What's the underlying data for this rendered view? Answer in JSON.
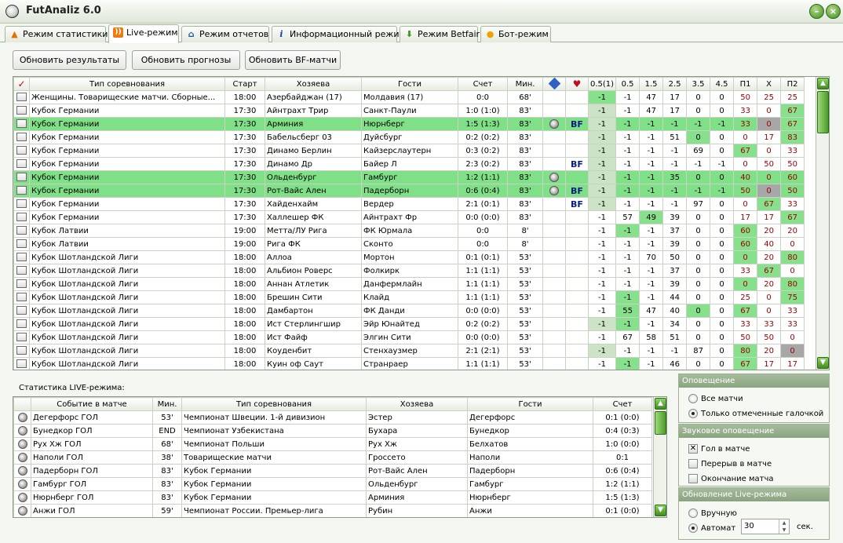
{
  "window": {
    "title": "FutAnaliz 6.0"
  },
  "tabs": [
    {
      "label": "Режим статистики",
      "icon": "warning-icon",
      "color": "#e07000"
    },
    {
      "label": "Live-режим",
      "icon": "rss-icon",
      "color": "#f07a10"
    },
    {
      "label": "Режим отчетов",
      "icon": "home-icon",
      "color": "#2055a0"
    },
    {
      "label": "Информационный режим",
      "icon": "info-icon",
      "color": "#1a3fb0"
    },
    {
      "label": "Режим Betfair",
      "icon": "arrow-down-icon",
      "color": "#3a9a20"
    },
    {
      "label": "Бот-режим",
      "icon": "chat-bubble-icon",
      "color": "#f0a000"
    }
  ],
  "toolbar": {
    "refresh_results": "Обновить результаты",
    "refresh_forecasts": "Обновить прогнозы",
    "refresh_bf": "Обновить BF-матчи"
  },
  "main_table": {
    "check_header": "✓",
    "columns": [
      "Тип соревнования",
      "Старт",
      "Хозяева",
      "Гости",
      "Счет",
      "Мин.",
      "",
      "",
      "0.5(1)",
      "0.5",
      "1.5",
      "2.5",
      "3.5",
      "4.5",
      "П1",
      "X",
      "П2"
    ],
    "rows": [
      {
        "comp": "Женщины. Товарищеские матчи. Сборные...",
        "start": "18:00",
        "home": "Азербайджан (17)",
        "away": "Молдавия (17)",
        "score": "0:0",
        "min": "68'",
        "ball": false,
        "bf": false,
        "o05h": "-1",
        "o05": "-1",
        "o15": "47",
        "o25": "17",
        "o35": "0",
        "o45": "0",
        "p1": "50",
        "x": "25",
        "p2": "25",
        "hl": false,
        "green": [
          "o05h"
        ],
        "gray": [],
        "lg": [
          "o05h"
        ]
      },
      {
        "comp": "Кубок Германии",
        "start": "17:30",
        "home": "Айнтрахт Трир",
        "away": "Санкт-Паули",
        "score": "1:0 (1:0)",
        "min": "83'",
        "ball": false,
        "bf": false,
        "o05h": "-1",
        "o05": "-1",
        "o15": "47",
        "o25": "17",
        "o35": "0",
        "o45": "0",
        "p1": "33",
        "x": "0",
        "p2": "67",
        "hl": false,
        "green": [
          "p2"
        ],
        "gray": [],
        "lg": [
          "o05h"
        ]
      },
      {
        "comp": "Кубок Германии",
        "start": "17:30",
        "home": "Арминия",
        "away": "Нюрнберг",
        "score": "1:5 (1:3)",
        "min": "83'",
        "ball": true,
        "bf": true,
        "o05h": "-1",
        "o05": "-1",
        "o15": "-1",
        "o25": "-1",
        "o35": "-1",
        "o45": "-1",
        "p1": "33",
        "x": "0",
        "p2": "67",
        "hl": true,
        "green": [
          "p2"
        ],
        "gray": [
          "x"
        ],
        "lg": [
          "o05h"
        ]
      },
      {
        "comp": "Кубок Германии",
        "start": "17:30",
        "home": "Бабельсберг 03",
        "away": "Дуйсбург",
        "score": "0:2 (0:2)",
        "min": "83'",
        "ball": false,
        "bf": false,
        "o05h": "-1",
        "o05": "-1",
        "o15": "-1",
        "o25": "51",
        "o35": "0",
        "o45": "0",
        "p1": "0",
        "x": "17",
        "p2": "83",
        "hl": false,
        "green": [
          "o35",
          "p2"
        ],
        "gray": [],
        "lg": [
          "o05h"
        ]
      },
      {
        "comp": "Кубок Германии",
        "start": "17:30",
        "home": "Динамо Берлин",
        "away": "Кайзерслаутерн",
        "score": "0:3 (0:2)",
        "min": "83'",
        "ball": false,
        "bf": false,
        "o05h": "-1",
        "o05": "-1",
        "o15": "-1",
        "o25": "-1",
        "o35": "69",
        "o45": "0",
        "p1": "67",
        "x": "0",
        "p2": "33",
        "hl": false,
        "green": [
          "p1"
        ],
        "gray": [],
        "lg": [
          "o05h"
        ]
      },
      {
        "comp": "Кубок Германии",
        "start": "17:30",
        "home": "Динамо Др",
        "away": "Байер Л",
        "score": "2:3 (0:2)",
        "min": "83'",
        "ball": false,
        "bf": true,
        "o05h": "-1",
        "o05": "-1",
        "o15": "-1",
        "o25": "-1",
        "o35": "-1",
        "o45": "-1",
        "p1": "0",
        "x": "50",
        "p2": "50",
        "hl": false,
        "green": [],
        "gray": [],
        "lg": [
          "o05h"
        ]
      },
      {
        "comp": "Кубок Германии",
        "start": "17:30",
        "home": "Ольденбург",
        "away": "Гамбург",
        "score": "1:2 (1:1)",
        "min": "83'",
        "ball": true,
        "bf": false,
        "o05h": "-1",
        "o05": "-1",
        "o15": "-1",
        "o25": "35",
        "o35": "0",
        "o45": "0",
        "p1": "40",
        "x": "0",
        "p2": "60",
        "hl": true,
        "green": [],
        "gray": [],
        "lg": [
          "o05h"
        ]
      },
      {
        "comp": "Кубок Германии",
        "start": "17:30",
        "home": "Рот-Вайс Ален",
        "away": "Падерборн",
        "score": "0:6 (0:4)",
        "min": "83'",
        "ball": true,
        "bf": true,
        "o05h": "-1",
        "o05": "-1",
        "o15": "-1",
        "o25": "-1",
        "o35": "-1",
        "o45": "-1",
        "p1": "50",
        "x": "0",
        "p2": "50",
        "hl": true,
        "green": [],
        "gray": [
          "x"
        ],
        "lg": [
          "o05h"
        ]
      },
      {
        "comp": "Кубок Германии",
        "start": "17:30",
        "home": "Хайденхайм",
        "away": "Вердер",
        "score": "2:1 (0:1)",
        "min": "83'",
        "ball": false,
        "bf": true,
        "o05h": "-1",
        "o05": "-1",
        "o15": "-1",
        "o25": "-1",
        "o35": "97",
        "o45": "0",
        "p1": "0",
        "x": "67",
        "p2": "33",
        "hl": false,
        "green": [
          "x"
        ],
        "gray": [],
        "lg": [
          "o05h"
        ]
      },
      {
        "comp": "Кубок Германии",
        "start": "17:30",
        "home": "Халлешер ФК",
        "away": "Айнтрахт Фр",
        "score": "0:0 (0:0)",
        "min": "83'",
        "ball": false,
        "bf": false,
        "o05h": "-1",
        "o05": "57",
        "o15": "49",
        "o25": "39",
        "o35": "0",
        "o45": "0",
        "p1": "17",
        "x": "17",
        "p2": "67",
        "hl": false,
        "green": [
          "o15",
          "p2"
        ],
        "gray": [],
        "lg": []
      },
      {
        "comp": "Кубок Латвии",
        "start": "19:00",
        "home": "Метта/ЛУ Рига",
        "away": "ФК Юрмала",
        "score": "0:0",
        "min": "8'",
        "ball": false,
        "bf": false,
        "o05h": "-1",
        "o05": "-1",
        "o15": "-1",
        "o25": "37",
        "o35": "0",
        "o45": "0",
        "p1": "60",
        "x": "20",
        "p2": "20",
        "hl": false,
        "green": [
          "o05",
          "p1"
        ],
        "gray": [],
        "lg": []
      },
      {
        "comp": "Кубок Латвии",
        "start": "19:00",
        "home": "Рига ФК",
        "away": "Сконто",
        "score": "0:0",
        "min": "8'",
        "ball": false,
        "bf": false,
        "o05h": "-1",
        "o05": "-1",
        "o15": "-1",
        "o25": "39",
        "o35": "0",
        "o45": "0",
        "p1": "60",
        "x": "40",
        "p2": "0",
        "hl": false,
        "green": [
          "p1"
        ],
        "gray": [],
        "lg": []
      },
      {
        "comp": "Кубок Шотландской Лиги",
        "start": "18:00",
        "home": "Аллоа",
        "away": "Мортон",
        "score": "0:1 (0:1)",
        "min": "53'",
        "ball": false,
        "bf": false,
        "o05h": "-1",
        "o05": "-1",
        "o15": "70",
        "o25": "50",
        "o35": "0",
        "o45": "0",
        "p1": "0",
        "x": "20",
        "p2": "80",
        "hl": false,
        "green": [
          "p1",
          "p2"
        ],
        "gray": [],
        "lg": []
      },
      {
        "comp": "Кубок Шотландской Лиги",
        "start": "18:00",
        "home": "Альбион Роверс",
        "away": "Фолкирк",
        "score": "1:1 (1:1)",
        "min": "53'",
        "ball": false,
        "bf": false,
        "o05h": "-1",
        "o05": "-1",
        "o15": "-1",
        "o25": "37",
        "o35": "0",
        "o45": "0",
        "p1": "33",
        "x": "67",
        "p2": "0",
        "hl": false,
        "green": [
          "x"
        ],
        "gray": [],
        "lg": []
      },
      {
        "comp": "Кубок Шотландской Лиги",
        "start": "18:00",
        "home": "Аннан Атлетик",
        "away": "Данфермлайн",
        "score": "1:1 (1:1)",
        "min": "53'",
        "ball": false,
        "bf": false,
        "o05h": "-1",
        "o05": "-1",
        "o15": "-1",
        "o25": "39",
        "o35": "0",
        "o45": "0",
        "p1": "0",
        "x": "20",
        "p2": "80",
        "hl": false,
        "green": [
          "p1",
          "p2"
        ],
        "gray": [],
        "lg": []
      },
      {
        "comp": "Кубок Шотландской Лиги",
        "start": "18:00",
        "home": "Брешин Сити",
        "away": "Клайд",
        "score": "1:1 (1:1)",
        "min": "53'",
        "ball": false,
        "bf": false,
        "o05h": "-1",
        "o05": "-1",
        "o15": "-1",
        "o25": "44",
        "o35": "0",
        "o45": "0",
        "p1": "25",
        "x": "0",
        "p2": "75",
        "hl": false,
        "green": [
          "o05",
          "p2"
        ],
        "gray": [],
        "lg": []
      },
      {
        "comp": "Кубок Шотландской Лиги",
        "start": "18:00",
        "home": "Дамбартон",
        "away": "ФК Данди",
        "score": "0:0 (0:0)",
        "min": "53'",
        "ball": false,
        "bf": false,
        "o05h": "-1",
        "o05": "55",
        "o15": "47",
        "o25": "40",
        "o35": "0",
        "o45": "0",
        "p1": "67",
        "x": "0",
        "p2": "33",
        "hl": false,
        "green": [
          "o05",
          "o35",
          "p1"
        ],
        "gray": [],
        "lg": []
      },
      {
        "comp": "Кубок Шотландской Лиги",
        "start": "18:00",
        "home": "Ист Стерлингшир",
        "away": "Эйр Юнайтед",
        "score": "0:2 (0:2)",
        "min": "53'",
        "ball": false,
        "bf": false,
        "o05h": "-1",
        "o05": "-1",
        "o15": "-1",
        "o25": "34",
        "o35": "0",
        "o45": "0",
        "p1": "33",
        "x": "33",
        "p2": "33",
        "hl": false,
        "green": [
          "o05"
        ],
        "gray": [],
        "lg": [
          "o05h"
        ]
      },
      {
        "comp": "Кубок Шотландской Лиги",
        "start": "18:00",
        "home": "Ист Файф",
        "away": "Элгин Сити",
        "score": "0:0 (0:0)",
        "min": "53'",
        "ball": false,
        "bf": false,
        "o05h": "-1",
        "o05": "67",
        "o15": "58",
        "o25": "51",
        "o35": "0",
        "o45": "0",
        "p1": "50",
        "x": "50",
        "p2": "0",
        "hl": false,
        "green": [],
        "gray": [],
        "lg": []
      },
      {
        "comp": "Кубок Шотландской Лиги",
        "start": "18:00",
        "home": "Коуденбит",
        "away": "Стенхаузмер",
        "score": "2:1 (2:1)",
        "min": "53'",
        "ball": false,
        "bf": false,
        "o05h": "-1",
        "o05": "-1",
        "o15": "-1",
        "o25": "-1",
        "o35": "87",
        "o45": "0",
        "p1": "80",
        "x": "20",
        "p2": "0",
        "hl": false,
        "green": [
          "p1"
        ],
        "gray": [
          "p2"
        ],
        "lg": [
          "o05h"
        ]
      },
      {
        "comp": "Кубок Шотландской Лиги",
        "start": "18:00",
        "home": "Куин оф Саут",
        "away": "Странраер",
        "score": "1:1 (1:1)",
        "min": "53'",
        "ball": false,
        "bf": false,
        "o05h": "-1",
        "o05": "-1",
        "o15": "-1",
        "o25": "46",
        "o35": "0",
        "o45": "0",
        "p1": "67",
        "x": "17",
        "p2": "17",
        "hl": false,
        "green": [
          "o05",
          "p1"
        ],
        "gray": [],
        "lg": []
      }
    ]
  },
  "live_stats": {
    "label": "Статистика LIVE-режима:",
    "columns": [
      "Событие в матче",
      "Мин.",
      "Тип соревнования",
      "Хозяева",
      "Гости",
      "Счет"
    ],
    "rows": [
      {
        "event": "Дегерфорс ГОЛ",
        "min": "53'",
        "comp": "Чемпионат Швеции. 1-й дивизион",
        "home": "Эстер",
        "away": "Дегерфорс",
        "score": "0:1 (0:0)"
      },
      {
        "event": "Бунедкор ГОЛ",
        "min": "END",
        "comp": "Чемпионат Узбекистана",
        "home": "Бухара",
        "away": "Бунедкор",
        "score": "0:4 (0:3)"
      },
      {
        "event": "Рух Хж ГОЛ",
        "min": "68'",
        "comp": "Чемпионат Польши",
        "home": "Рух Хж",
        "away": "Белхатов",
        "score": "1:0 (0:0)"
      },
      {
        "event": "Наполи ГОЛ",
        "min": "38'",
        "comp": "Товарищеские матчи",
        "home": "Гроссето",
        "away": "Наполи",
        "score": "0:1"
      },
      {
        "event": "Падерборн ГОЛ",
        "min": "83'",
        "comp": "Кубок Германии",
        "home": "Рот-Вайс Ален",
        "away": "Падерборн",
        "score": "0:6 (0:4)"
      },
      {
        "event": "Гамбург ГОЛ",
        "min": "83'",
        "comp": "Кубок Германии",
        "home": "Ольденбург",
        "away": "Гамбург",
        "score": "1:2 (1:1)"
      },
      {
        "event": "Нюрнберг ГОЛ",
        "min": "83'",
        "comp": "Кубок Германии",
        "home": "Арминия",
        "away": "Нюрнберг",
        "score": "1:5 (1:3)"
      },
      {
        "event": "Анжи ГОЛ",
        "min": "59'",
        "comp": "Чемпионат России. Премьер-лига",
        "home": "Рубин",
        "away": "Анжи",
        "score": "0:1 (0:0)"
      }
    ]
  },
  "notify": {
    "title": "Оповещение",
    "all": "Все матчи",
    "checked": "Только отмеченные галочкой"
  },
  "sound": {
    "title": "Звуковое оповещение",
    "goal": "Гол в матче",
    "break": "Перерыв в матче",
    "end": "Окончание матча"
  },
  "update": {
    "title": "Обновление Live-режима",
    "manual": "Вручную",
    "auto": "Автомат",
    "interval": "30",
    "unit": "сек."
  }
}
